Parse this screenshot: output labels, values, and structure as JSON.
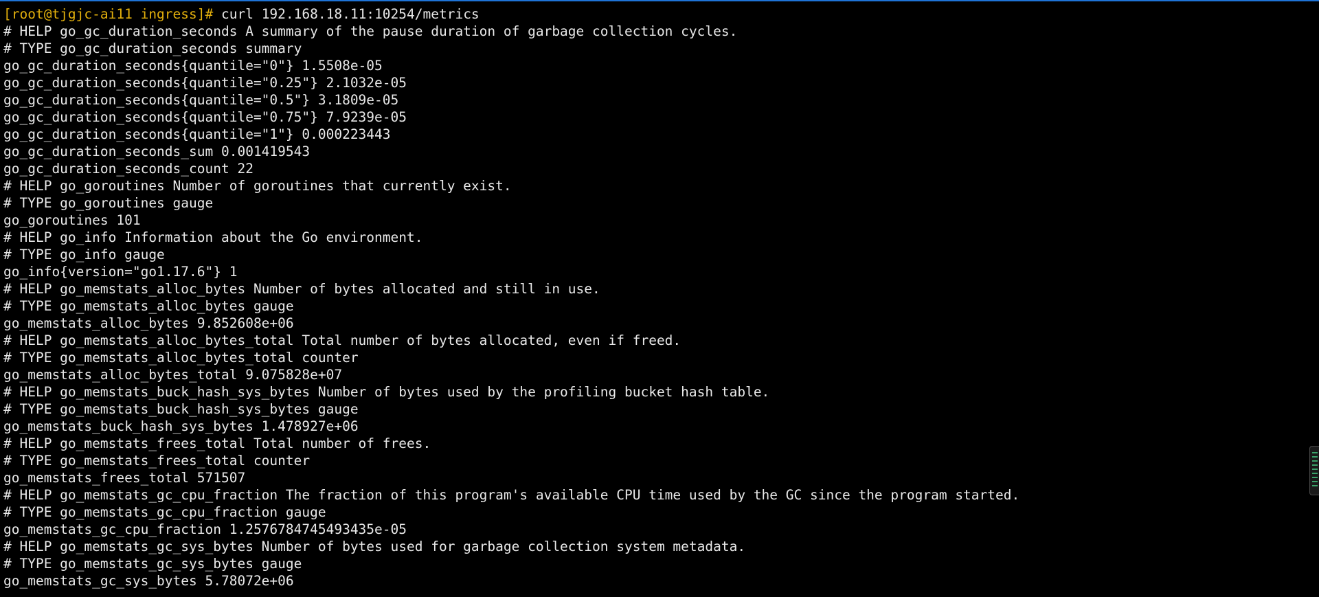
{
  "terminal": {
    "prompt": "[root@tjgjc-ai11 ingress]#",
    "command": " curl 192.168.18.11:10254/metrics",
    "output": [
      "# HELP go_gc_duration_seconds A summary of the pause duration of garbage collection cycles.",
      "# TYPE go_gc_duration_seconds summary",
      "go_gc_duration_seconds{quantile=\"0\"} 1.5508e-05",
      "go_gc_duration_seconds{quantile=\"0.25\"} 2.1032e-05",
      "go_gc_duration_seconds{quantile=\"0.5\"} 3.1809e-05",
      "go_gc_duration_seconds{quantile=\"0.75\"} 7.9239e-05",
      "go_gc_duration_seconds{quantile=\"1\"} 0.000223443",
      "go_gc_duration_seconds_sum 0.001419543",
      "go_gc_duration_seconds_count 22",
      "# HELP go_goroutines Number of goroutines that currently exist.",
      "# TYPE go_goroutines gauge",
      "go_goroutines 101",
      "# HELP go_info Information about the Go environment.",
      "# TYPE go_info gauge",
      "go_info{version=\"go1.17.6\"} 1",
      "# HELP go_memstats_alloc_bytes Number of bytes allocated and still in use.",
      "# TYPE go_memstats_alloc_bytes gauge",
      "go_memstats_alloc_bytes 9.852608e+06",
      "# HELP go_memstats_alloc_bytes_total Total number of bytes allocated, even if freed.",
      "# TYPE go_memstats_alloc_bytes_total counter",
      "go_memstats_alloc_bytes_total 9.075828e+07",
      "# HELP go_memstats_buck_hash_sys_bytes Number of bytes used by the profiling bucket hash table.",
      "# TYPE go_memstats_buck_hash_sys_bytes gauge",
      "go_memstats_buck_hash_sys_bytes 1.478927e+06",
      "# HELP go_memstats_frees_total Total number of frees.",
      "# TYPE go_memstats_frees_total counter",
      "go_memstats_frees_total 571507",
      "# HELP go_memstats_gc_cpu_fraction The fraction of this program's available CPU time used by the GC since the program started.",
      "# TYPE go_memstats_gc_cpu_fraction gauge",
      "go_memstats_gc_cpu_fraction 1.2576784745493435e-05",
      "# HELP go_memstats_gc_sys_bytes Number of bytes used for garbage collection system metadata.",
      "# TYPE go_memstats_gc_sys_bytes gauge",
      "go_memstats_gc_sys_bytes 5.78072e+06"
    ]
  },
  "colors": {
    "prompt": "#e3b00c",
    "text": "#e8e8e8",
    "background": "#000000",
    "top_border": "#1e73d6"
  },
  "icons": {
    "scroll_indicator": "scroll-indicator-icon"
  }
}
